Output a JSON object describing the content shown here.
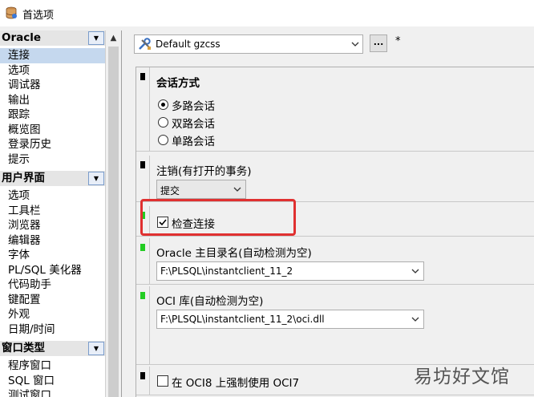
{
  "window": {
    "title": "首选项"
  },
  "sidebar": {
    "groups": [
      {
        "header": "Oracle",
        "items": [
          "连接",
          "选项",
          "调试器",
          "输出",
          "跟踪",
          "概览图",
          "登录历史",
          "提示"
        ]
      },
      {
        "header": "用户界面",
        "items": [
          "选项",
          "工具栏",
          "浏览器",
          "编辑器",
          "字体",
          "PL/SQL 美化器",
          "代码助手",
          "键配置",
          "外观",
          "日期/时间"
        ]
      },
      {
        "header": "窗口类型",
        "items": [
          "程序窗口",
          "SQL 窗口",
          "测试窗口"
        ]
      }
    ],
    "selected": "连接"
  },
  "toolbar": {
    "profile_value": "Default gzcss",
    "ellipsis": "...",
    "modified": "*"
  },
  "sections": {
    "session_mode": {
      "label": "会话方式",
      "options": [
        "多路会话",
        "双路会话",
        "单路会话"
      ],
      "selected_index": 0
    },
    "logoff": {
      "label": "注销(有打开的事务)",
      "value": "提交"
    },
    "check_connection": {
      "label": "检查连接",
      "checked": true
    },
    "oracle_home": {
      "label": "Oracle 主目录名(自动检测为空)",
      "value": "F:\\PLSQL\\instantclient_11_2"
    },
    "oci_library": {
      "label": "OCI 库(自动检测为空)",
      "value": "F:\\PLSQL\\instantclient_11_2\\oci.dll"
    },
    "force_oci7": {
      "label": "在 OCI8 上强制使用 OCI7",
      "checked": false
    }
  },
  "colors": {
    "marker_black": "#000000",
    "marker_green": "#22cc22",
    "highlight": "#e03030",
    "selected_bg": "#c5d8ee"
  },
  "watermark": {
    "text": "易坊好文馆"
  }
}
